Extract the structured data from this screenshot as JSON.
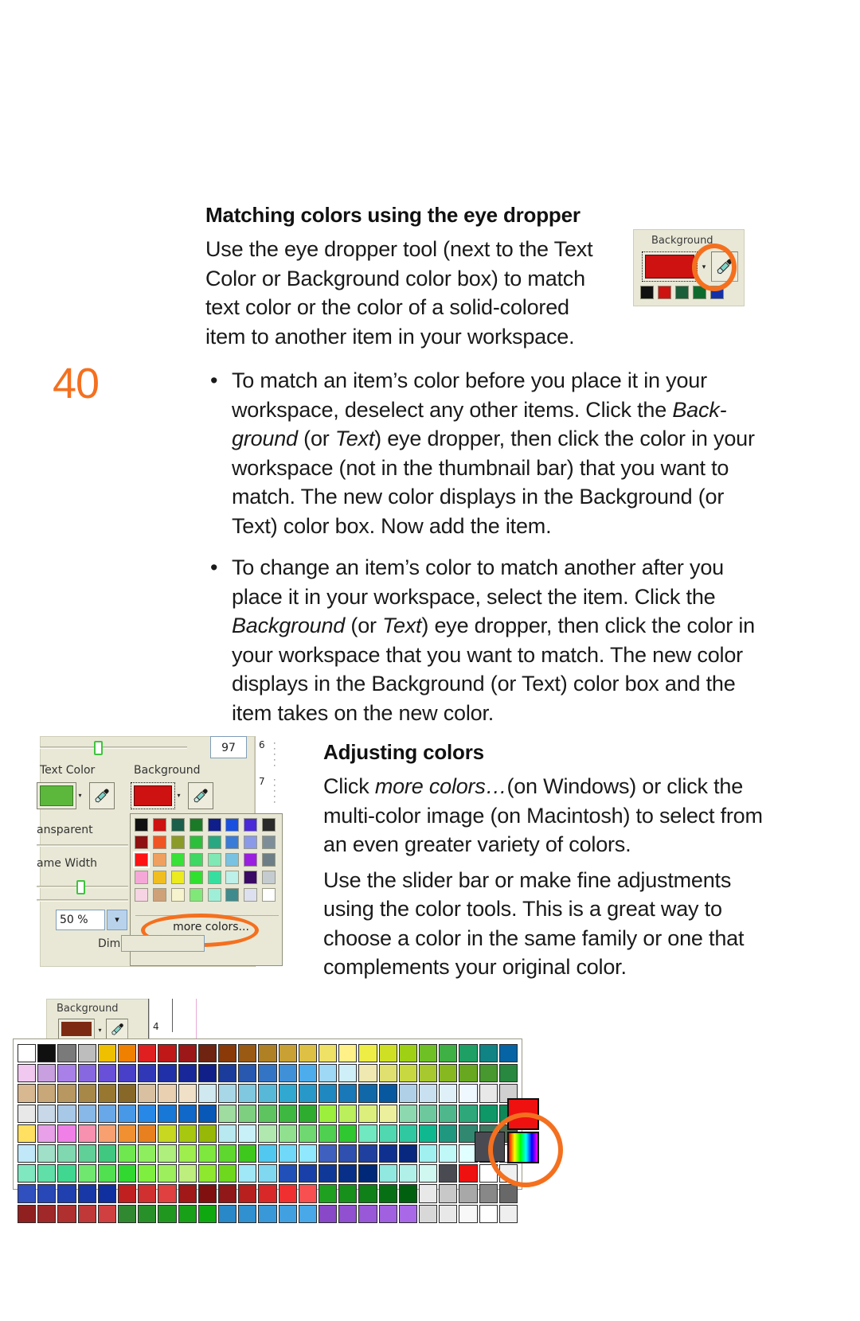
{
  "page": {
    "number": "40",
    "accent_color": "#F4701F"
  },
  "sections": [
    {
      "heading": "Matching colors using the eye dropper",
      "body": "Use the eye dropper tool (next to the Text Color or Background color box) to match text color or the color of a solid-colored item to another item in your workspace."
    },
    {
      "heading": "Adjusting colors",
      "body1_pre": "Click ",
      "body1_em": "more colors…",
      "body1_post": "(on Windows) or click the multi-color image (on Macintosh) to select from an even greater variety of colors.",
      "body2": "Use the slider bar or make fine adjustments using the color tools. This is a great way to choose a color in the same family or one that complements your original color."
    }
  ],
  "bullets": [
    {
      "marker": "•",
      "pre": "To match an item’s color before you place it in your workspace, deselect any other items. Click the ",
      "em1": "Back-ground",
      "mid1": " (or ",
      "em2": "Text",
      "post": ") eye dropper, then click the color in your workspace (not in the thumbnail bar) that you want to match. The new color displays in the Background (or Text) color box. Now add the item."
    },
    {
      "marker": "•",
      "pre": "To change an item’s color to match another after you place it in your workspace, select the item. Click the ",
      "em1": "Background",
      "mid1": " (or ",
      "em2": "Text",
      "post": ") eye dropper, then click the color in your workspace that you want to match. The new color displays in the Background (or Text) color box and the item takes on the new color."
    }
  ],
  "screenshot_top": {
    "label": "Background",
    "color_value": "#CE1111",
    "dropdown_arrow": "▾",
    "dropper_icon": "eyedropper-icon",
    "swatches": [
      "#111111",
      "#CE1111",
      "#1B5E3A",
      "#0E6B2E",
      "#1430A8"
    ]
  },
  "screenshot_panel": {
    "number_field_value": "97",
    "ruler_marks": [
      "6",
      "7"
    ],
    "text_color_label": "Text Color",
    "text_color_value": "#5CB83C",
    "background_label": "Background",
    "background_value": "#CE1111",
    "transparent_label": "ansparent",
    "frame_width_label": "ame Width",
    "percent_value": "50 %",
    "dim_label": "Dim",
    "more_colors_label": "more colors...",
    "dropdown_arrow": "▾",
    "spinner_arrow": "▾",
    "grid_colors": [
      "#111111",
      "#CE1111",
      "#1B5E4A",
      "#1A7A28",
      "#101E8C",
      "#1A50E0",
      "#4A2AD8",
      "#2A2A2A",
      "#8E1010",
      "#F05423",
      "#8B9B28",
      "#2BBF3C",
      "#27A882",
      "#3A7BD8",
      "#8A9AE8",
      "#7E8E99",
      "#FF1414",
      "#EFA060",
      "#38E038",
      "#3ED862",
      "#7FE8B4",
      "#79C2E2",
      "#9B1FE0",
      "#6E7E86",
      "#F5A8D8",
      "#F0BE20",
      "#ECEB20",
      "#2FE02F",
      "#36DFA0",
      "#BCF0E8",
      "#3A0A66",
      "#C4CCD0",
      "#F6D4E4",
      "#CFA179",
      "#F6F4CE",
      "#80E878",
      "#9FEFD8",
      "#3E8A8C",
      "#DDE0EE",
      "#FFFFFF"
    ],
    "grid_selected_index": 16
  },
  "screenshot_palette": {
    "label": "Background",
    "color_value": "#7D2A12",
    "dropper_icon": "eyedropper-icon",
    "ruler_mark": "4",
    "highlight_red": "#EF1010",
    "highlight_gray": "#4A4A52",
    "multicolor_icon": "rainbow-gradient-swatch",
    "palette_rows": 9,
    "palette_cols": 25
  },
  "annotations": {
    "circle_color": "#F4701F",
    "circles": [
      "dropper-top",
      "more-colors",
      "multicolor-swatch"
    ]
  }
}
